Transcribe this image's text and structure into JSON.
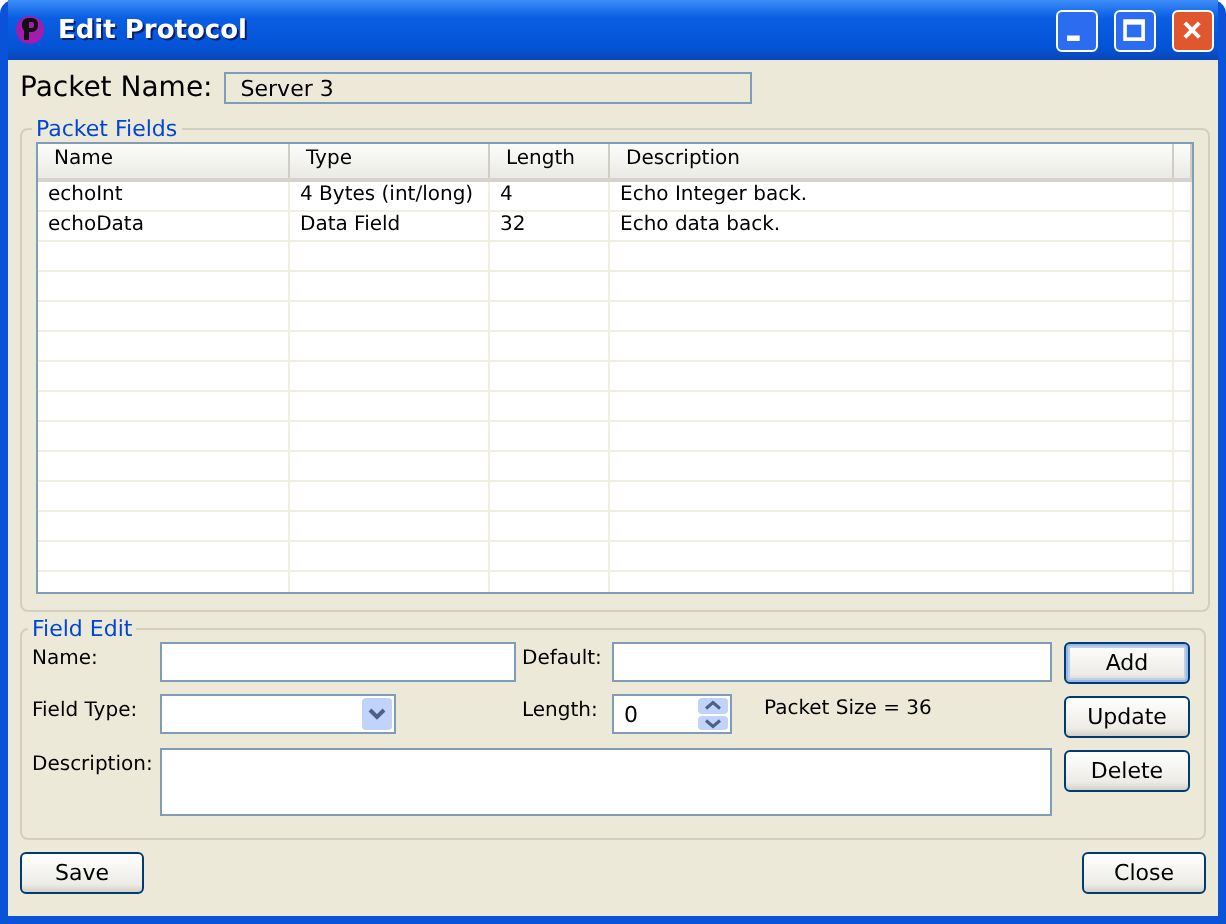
{
  "window": {
    "title": "Edit Protocol"
  },
  "packet_name": {
    "label": "Packet Name:",
    "value": "Server 3"
  },
  "packet_fields": {
    "title": "Packet Fields",
    "columns": [
      "Name",
      "Type",
      "Length",
      "Description"
    ],
    "rows": [
      {
        "cells": [
          "echoInt",
          "4 Bytes (int/long)",
          "4",
          "Echo Integer back."
        ]
      },
      {
        "cells": [
          "echoData",
          "Data Field",
          "32",
          "Echo data back."
        ]
      }
    ]
  },
  "field_edit": {
    "title": "Field Edit",
    "name": {
      "label": "Name:"
    },
    "default": {
      "label": "Default:"
    },
    "field_type": {
      "label": "Field Type:"
    },
    "length": {
      "label": "Length:",
      "value": "0"
    },
    "packet_size": "Packet Size = 36",
    "description": {
      "label": "Description:"
    },
    "buttons": [
      {
        "label": "Add",
        "focused": true
      },
      {
        "label": "Update",
        "focused": false
      },
      {
        "label": "Delete",
        "focused": false
      }
    ]
  },
  "footer_buttons": [
    {
      "label": "Save",
      "focused": false
    },
    {
      "label": "Close",
      "focused": false
    }
  ]
}
